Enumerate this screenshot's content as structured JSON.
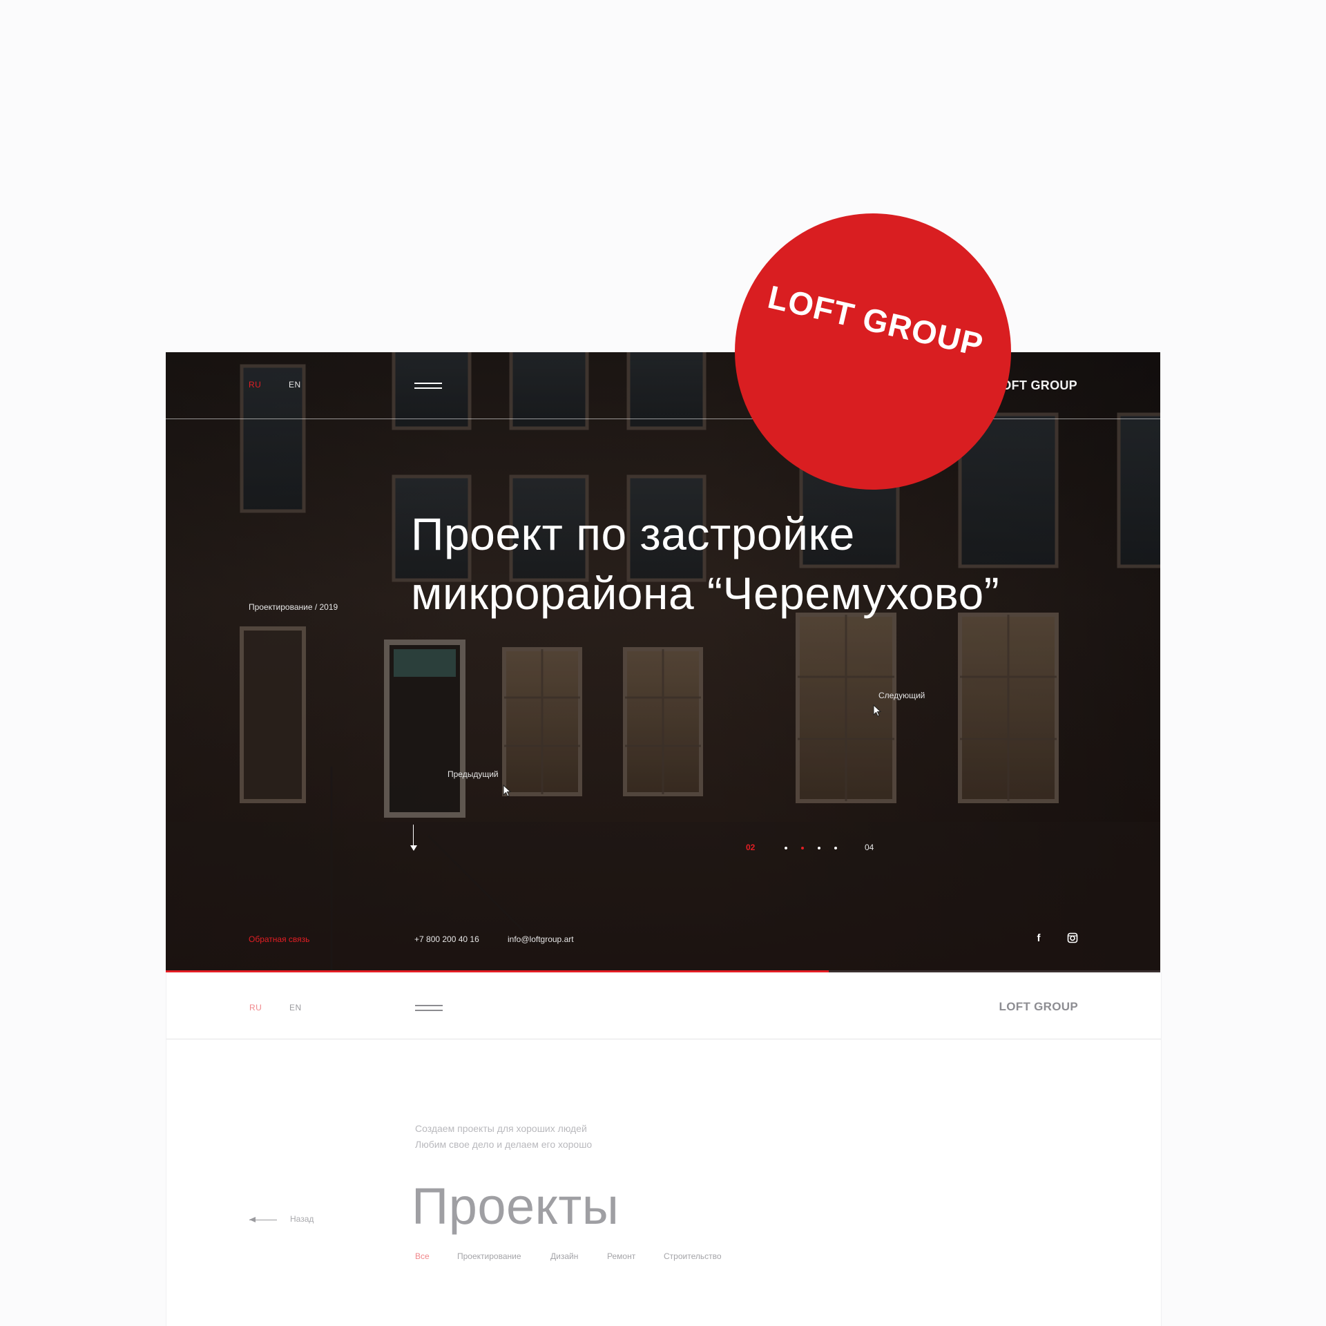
{
  "colors": {
    "accent": "#e31e24",
    "badge": "#d91e21",
    "dark_bg": "#221a17",
    "light_bg": "#ffffff",
    "muted_text": "#a4a4a8"
  },
  "badge": {
    "logo_text": "LOFT GROUP"
  },
  "hero": {
    "languages": {
      "active": "RU",
      "other": "EN"
    },
    "menu_icon": "hamburger-icon",
    "brand": "LOFT GROUP",
    "meta": "Проектирование / 2019",
    "title_line1": "Проект по застройке",
    "title_line2": "микрорайона “Черемухово”",
    "next_label": "Следующий",
    "prev_label": "Предыдущий",
    "scroll_icon": "arrow-down-icon",
    "pager": {
      "current": "02",
      "total": "04",
      "active_dot": 2,
      "dots": 4
    },
    "footer": {
      "feedback": "Обратная связь",
      "phone": "+7 800 200 40 16",
      "email": "info@loftgroup.art",
      "social": [
        "facebook-icon",
        "instagram-icon"
      ]
    },
    "progress": 0.667
  },
  "projects_page": {
    "languages": {
      "active": "RU",
      "other": "EN"
    },
    "brand": "LOFT GROUP",
    "tagline_line1": "Создаем проекты для хороших людей",
    "tagline_line2": "Любим свое дело и делаем его хорошо",
    "back_label": "Назад",
    "heading": "Проекты",
    "filters": [
      "Все",
      "Проектирование",
      "Дизайн",
      "Ремонт",
      "Строительство"
    ],
    "active_filter": "Все"
  }
}
